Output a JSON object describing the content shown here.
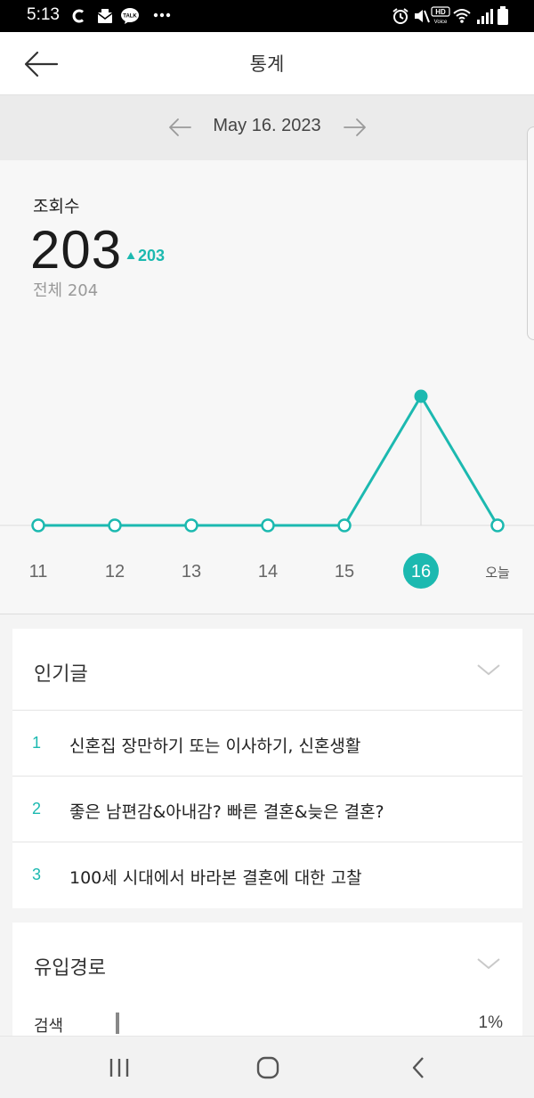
{
  "status_bar": {
    "time": "5:13",
    "left_icons": [
      "c-icon",
      "mail-icon",
      "talk-icon",
      "more-dots-icon"
    ],
    "right_icons": [
      "alarm-icon",
      "mute-icon",
      "hd-voice-icon",
      "wifi-icon",
      "signal-icon",
      "battery-icon"
    ],
    "talk_label": "TALK",
    "hd_label": "HD",
    "voice_label": "Voice"
  },
  "header": {
    "title": "통계"
  },
  "date_nav": {
    "date": "May 16. 2023"
  },
  "stats": {
    "label": "조회수",
    "value": "203",
    "delta": "203",
    "total_label": "전체 204"
  },
  "chart_data": {
    "type": "line",
    "x": [
      "11",
      "12",
      "13",
      "14",
      "15",
      "16",
      "오늘"
    ],
    "series": [
      {
        "values": [
          0,
          0,
          0,
          0,
          0,
          203,
          0
        ]
      }
    ],
    "selected": "16",
    "ylim": [
      0,
      203
    ],
    "accent_color": "#1cb9b0"
  },
  "popular": {
    "title": "인기글",
    "posts": [
      {
        "num": "1",
        "title": "신혼집 장만하기 또는 이사하기, 신혼생활"
      },
      {
        "num": "2",
        "title": "좋은 남편감&아내감? 빠른 결혼&늦은 결혼?"
      },
      {
        "num": "3",
        "title": "100세 시대에서 바라본 결혼에 대한 고찰"
      }
    ]
  },
  "inflow": {
    "title": "유입경로",
    "rows": [
      {
        "label": "검색",
        "percent": "1%",
        "fraction": 0.01
      }
    ]
  },
  "colors": {
    "accent": "#1cb9b0",
    "background": "#f7f7f7"
  }
}
